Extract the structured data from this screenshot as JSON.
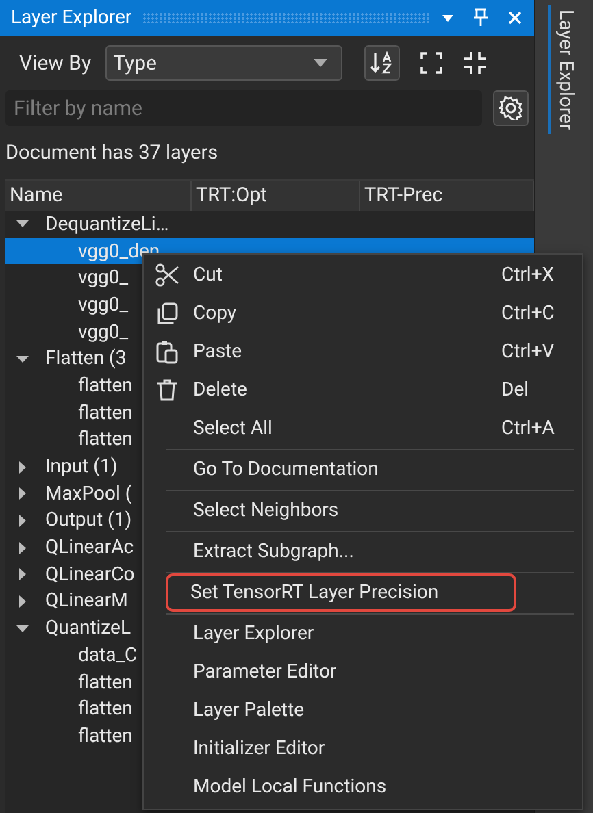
{
  "window": {
    "title": "Layer Explorer"
  },
  "side_tab": {
    "label": "Layer Explorer"
  },
  "toolbar": {
    "view_by_label": "View By",
    "view_by_value": "Type"
  },
  "filter": {
    "placeholder": "Filter by name"
  },
  "summary": "Document has 37 layers",
  "table": {
    "columns": [
      "Name",
      "TRT:Opt",
      "TRT-Prec"
    ],
    "rows": [
      {
        "name": "DequantizeLi…",
        "expanded": true,
        "selected": false,
        "children": [
          {
            "name": "vgg0_den",
            "selected": true
          },
          {
            "name": "vgg0_",
            "selected": false
          },
          {
            "name": "vgg0_",
            "selected": false
          },
          {
            "name": "vgg0_",
            "selected": false
          }
        ]
      },
      {
        "name": "Flatten (3",
        "expanded": true,
        "selected": false,
        "children": [
          {
            "name": "flatten",
            "selected": false
          },
          {
            "name": "flatten",
            "selected": false
          },
          {
            "name": "flatten",
            "selected": false
          }
        ]
      },
      {
        "name": "Input (1)",
        "expanded": false,
        "selected": false
      },
      {
        "name": "MaxPool (",
        "expanded": false,
        "selected": false
      },
      {
        "name": "Output (1)",
        "expanded": false,
        "selected": false
      },
      {
        "name": "QLinearAc",
        "expanded": false,
        "selected": false
      },
      {
        "name": "QLinearCo",
        "expanded": false,
        "selected": false
      },
      {
        "name": "QLinearM",
        "expanded": false,
        "selected": false
      },
      {
        "name": "QuantizeL",
        "expanded": true,
        "selected": false,
        "children": [
          {
            "name": "data_C",
            "selected": false
          },
          {
            "name": "flatten",
            "selected": false
          },
          {
            "name": "flatten",
            "selected": false
          },
          {
            "name": "flatten",
            "selected": false
          }
        ]
      }
    ]
  },
  "context_menu": {
    "groups": [
      [
        {
          "kind": "cut",
          "label": "Cut",
          "shortcut": "Ctrl+X",
          "highlighted": false
        },
        {
          "kind": "copy",
          "label": "Copy",
          "shortcut": "Ctrl+C",
          "highlighted": false
        },
        {
          "kind": "paste",
          "label": "Paste",
          "shortcut": "Ctrl+V",
          "highlighted": false
        },
        {
          "kind": "delete",
          "label": "Delete",
          "shortcut": "Del",
          "highlighted": false
        },
        {
          "kind": "plain",
          "label": "Select All",
          "shortcut": "Ctrl+A",
          "highlighted": false
        }
      ],
      [
        {
          "kind": "plain",
          "label": "Go To Documentation",
          "highlighted": false
        }
      ],
      [
        {
          "kind": "plain",
          "label": "Select Neighbors",
          "highlighted": false
        }
      ],
      [
        {
          "kind": "plain",
          "label": "Extract Subgraph...",
          "highlighted": false
        }
      ],
      [
        {
          "kind": "plain",
          "label": "Set TensorRT Layer Precision",
          "highlighted": true
        }
      ],
      [
        {
          "kind": "plain",
          "label": "Layer Explorer",
          "highlighted": false
        },
        {
          "kind": "plain",
          "label": "Parameter Editor",
          "highlighted": false
        },
        {
          "kind": "plain",
          "label": "Layer Palette",
          "highlighted": false
        },
        {
          "kind": "plain",
          "label": "Initializer Editor",
          "highlighted": false
        },
        {
          "kind": "plain",
          "label": "Model Local Functions",
          "highlighted": false
        }
      ]
    ]
  }
}
